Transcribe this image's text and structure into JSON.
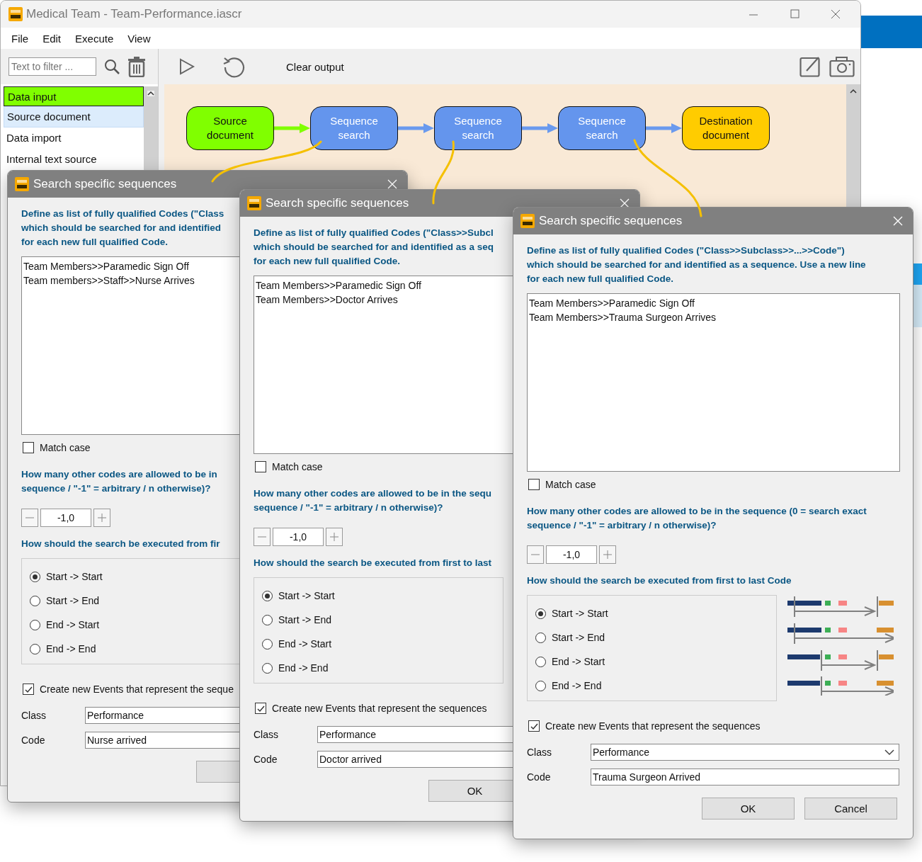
{
  "main_window": {
    "title": "Medical Team - Team-Performance.iascr",
    "menu": [
      "File",
      "Edit",
      "Execute",
      "View"
    ],
    "filter": {
      "placeholder": "Text to filter ..."
    },
    "palette": [
      {
        "kind": "group",
        "label": "Data input"
      },
      {
        "kind": "item",
        "label": "Source document",
        "selected": true
      },
      {
        "kind": "item",
        "label": "Data import",
        "selected": false
      },
      {
        "kind": "item",
        "label": "Internal text source",
        "selected": false
      }
    ],
    "clear_label": "Clear output",
    "nodes": [
      {
        "kind": "source",
        "label": "Source document"
      },
      {
        "kind": "search",
        "label": "Sequence search"
      },
      {
        "kind": "search",
        "label": "Sequence search"
      },
      {
        "kind": "search",
        "label": "Sequence search"
      },
      {
        "kind": "destination",
        "label": "Destination document"
      }
    ]
  },
  "dialogs": [
    {
      "title": "Search specific sequences",
      "intro": [
        "Define as list of fully qualified Codes (\"Class",
        "which should be searched for and identified",
        "for each new full qualified Code."
      ],
      "codes": [
        "Team Members>>Paramedic Sign Off",
        "Team members>>Staff>>Nurse Arrives"
      ],
      "match_case": {
        "label": "Match case",
        "checked": false
      },
      "gap_question": [
        "How many other codes are allowed to be in",
        "sequence / \"-1\" = arbitrary / n otherwise)?"
      ],
      "gap_value": "-1,0",
      "order_question": "How should the search be executed from fir",
      "order_options": [
        {
          "label": "Start -> Start",
          "selected": true
        },
        {
          "label": "Start -> End",
          "selected": false
        },
        {
          "label": "End -> Start",
          "selected": false
        },
        {
          "label": "End -> End",
          "selected": false
        }
      ],
      "create_events": {
        "label": "Create new Events that represent the seque",
        "checked": true
      },
      "class_field": {
        "label": "Class",
        "value": "Performance",
        "kind": "text"
      },
      "code_field": {
        "label": "Code",
        "value": "Nurse arrived"
      },
      "buttons": [
        {
          "kind": "covered"
        }
      ]
    },
    {
      "title": "Search specific sequences",
      "intro": [
        "Define as list of fully qualified Codes (\"Class>>Subcl",
        "which should be searched for and identified as a seq",
        "for each new full qualified Code."
      ],
      "codes": [
        "Team Members>>Paramedic Sign Off",
        "Team Members>>Doctor Arrives"
      ],
      "match_case": {
        "label": "Match case",
        "checked": false
      },
      "gap_question": [
        "How many other codes are allowed to be in the sequ",
        "sequence / \"-1\" = arbitrary / n otherwise)?"
      ],
      "gap_value": "-1,0",
      "order_question": "How should the search be executed from first to last",
      "order_options": [
        {
          "label": "Start -> Start",
          "selected": true
        },
        {
          "label": "Start -> End",
          "selected": false
        },
        {
          "label": "End -> Start",
          "selected": false
        },
        {
          "label": "End -> End",
          "selected": false
        }
      ],
      "create_events": {
        "label": "Create new Events that represent the sequences",
        "checked": true
      },
      "class_field": {
        "label": "Class",
        "value": "Performance",
        "kind": "text"
      },
      "code_field": {
        "label": "Code",
        "value": "Doctor arrived"
      },
      "buttons": [
        {
          "kind": "labeled",
          "label": "OK"
        }
      ]
    },
    {
      "title": "Search specific sequences",
      "intro": [
        "Define as list of fully qualified Codes (\"Class>>Subclass>>...>>Code\")",
        "which should be searched for and identified as a sequence. Use a new line",
        "for each new full qualified Code."
      ],
      "codes": [
        "Team Members>>Paramedic Sign Off",
        "Team Members>>Trauma Surgeon Arrives"
      ],
      "match_case": {
        "label": "Match case",
        "checked": false
      },
      "gap_question": [
        "How many other codes are allowed to be in the sequence (0 = search exact",
        "sequence / \"-1\" = arbitrary / n otherwise)?"
      ],
      "gap_value": "-1,0",
      "order_question": "How should the search be executed from first to last Code",
      "order_options": [
        {
          "label": "Start -> Start",
          "selected": true
        },
        {
          "label": "Start -> End",
          "selected": false
        },
        {
          "label": "End -> Start",
          "selected": false
        },
        {
          "label": "End -> End",
          "selected": false
        }
      ],
      "order_drawing": true,
      "create_events": {
        "label": "Create new Events that represent the sequences",
        "checked": true
      },
      "class_field": {
        "label": "Class",
        "value": "Performance",
        "kind": "dropdown"
      },
      "code_field": {
        "label": "Code",
        "value": "Trauma Surgeon Arrived"
      },
      "buttons": [
        {
          "kind": "labeled",
          "label": "OK"
        },
        {
          "kind": "labeled",
          "label": "Cancel"
        }
      ]
    }
  ]
}
